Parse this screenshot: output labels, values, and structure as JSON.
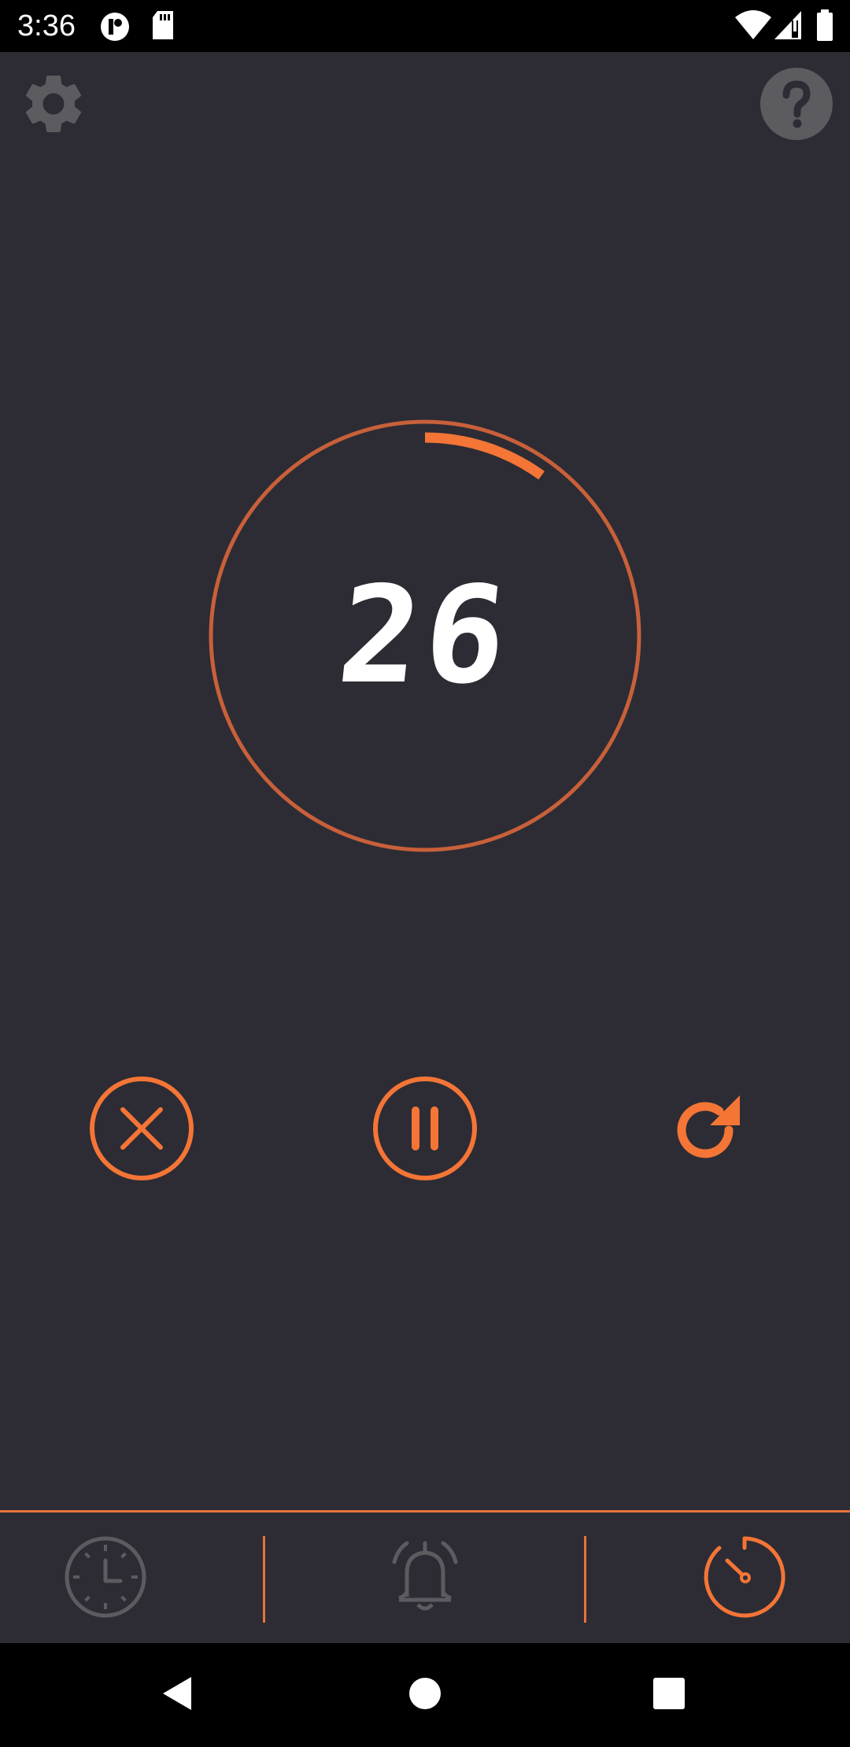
{
  "status_bar": {
    "time": "3:36",
    "icons": [
      "circle-badge-icon",
      "sd-card-icon",
      "wifi-icon",
      "signal-icon",
      "battery-icon"
    ]
  },
  "top_controls": {
    "left_icon": "gear-icon",
    "right_icon": "help-icon"
  },
  "timer": {
    "value": "26",
    "progress_fraction": 0.1
  },
  "actions": {
    "cancel_icon": "close-circle-icon",
    "pause_icon": "pause-circle-icon",
    "restart_icon": "restart-icon"
  },
  "bottom_nav": {
    "items": [
      {
        "icon": "clock-icon",
        "active": false
      },
      {
        "icon": "alarm-bell-icon",
        "active": false
      },
      {
        "icon": "timer-icon",
        "active": true
      }
    ]
  },
  "system_nav": {
    "icons": [
      "back-icon",
      "home-icon",
      "recents-icon"
    ]
  },
  "colors": {
    "background": "#2d2c34",
    "accent": "#f47536",
    "ring": "#c8603a",
    "inactive_icon": "#5b5b60",
    "text": "#ffffff"
  }
}
